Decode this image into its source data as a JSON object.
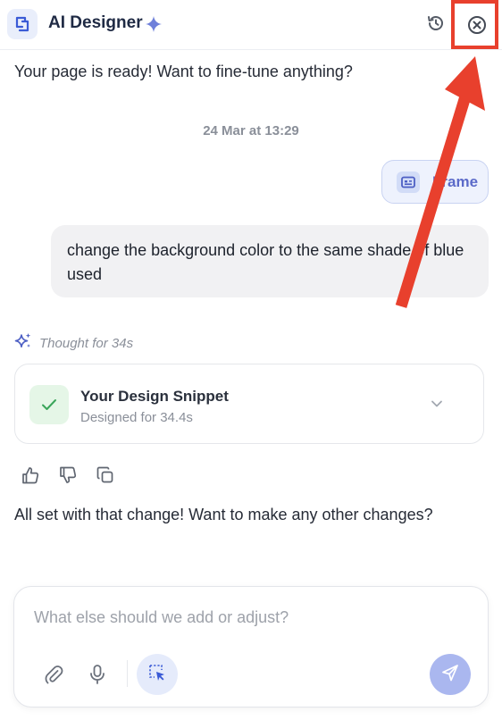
{
  "header": {
    "title": "AI Designer",
    "logo_icon": "app-logo-icon",
    "sparkle_icon": "sparkle-icon",
    "history_icon": "history-icon",
    "close_icon": "close-circle-icon"
  },
  "chat": {
    "intro": "Your page is ready! Want to fine-tune anything?",
    "timestamp": "24 Mar at 13:29",
    "frame_chip_label": "Frame",
    "user_message": "change the background color to the same shade of blue used",
    "thought_label": "Thought for 34s",
    "snippet": {
      "title": "Your Design Snippet",
      "subtitle": "Designed for 34.4s"
    },
    "reply": "All set with that change! Want to make any other changes?"
  },
  "composer": {
    "placeholder": "What else should we add or adjust?",
    "value": ""
  },
  "colors": {
    "accent": "#5b6ac9",
    "annotation_red": "#e8402d",
    "send_button": "#aab7ef",
    "success_bg": "#e5f6e7"
  }
}
